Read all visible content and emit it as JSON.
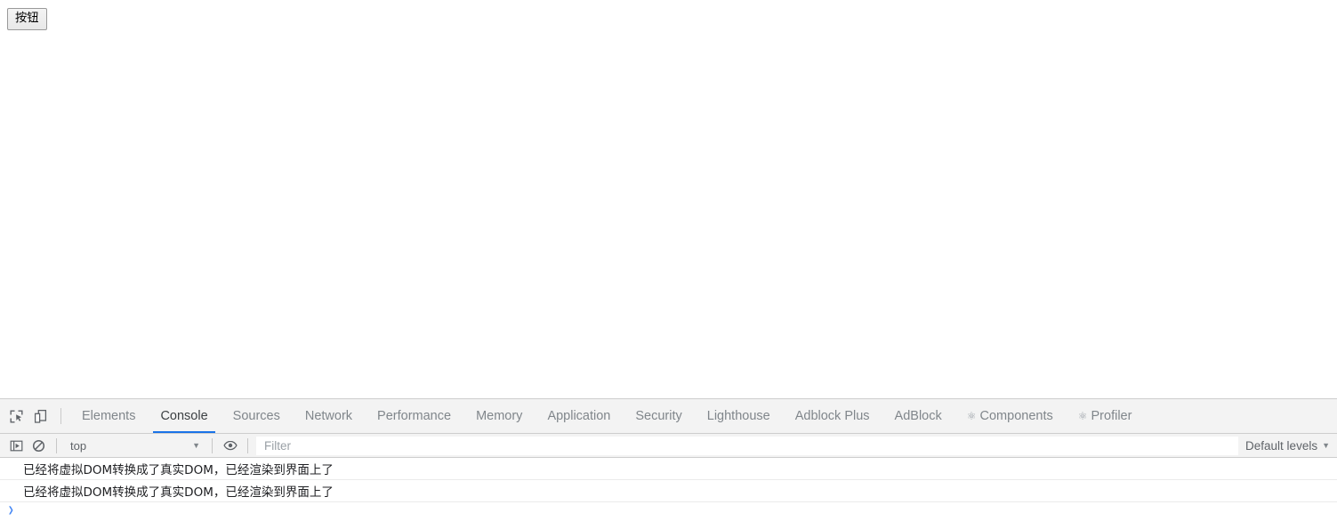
{
  "page": {
    "button_label": "按钮"
  },
  "devtools": {
    "left_icons": [
      {
        "name": "inspect-element-icon",
        "title": "Inspect"
      },
      {
        "name": "device-toolbar-icon",
        "title": "Toggle device toolbar"
      }
    ],
    "tabs": [
      {
        "label": "Elements",
        "active": false,
        "glyph": ""
      },
      {
        "label": "Console",
        "active": true,
        "glyph": ""
      },
      {
        "label": "Sources",
        "active": false,
        "glyph": ""
      },
      {
        "label": "Network",
        "active": false,
        "glyph": ""
      },
      {
        "label": "Performance",
        "active": false,
        "glyph": ""
      },
      {
        "label": "Memory",
        "active": false,
        "glyph": ""
      },
      {
        "label": "Application",
        "active": false,
        "glyph": ""
      },
      {
        "label": "Security",
        "active": false,
        "glyph": ""
      },
      {
        "label": "Lighthouse",
        "active": false,
        "glyph": ""
      },
      {
        "label": "Adblock Plus",
        "active": false,
        "glyph": ""
      },
      {
        "label": "AdBlock",
        "active": false,
        "glyph": ""
      },
      {
        "label": "Components",
        "active": false,
        "glyph": "⚛"
      },
      {
        "label": "Profiler",
        "active": false,
        "glyph": "⚛"
      }
    ],
    "console_toolbar": {
      "sidebar_toggle_name": "console-sidebar-toggle-icon",
      "clear_console_name": "clear-console-icon",
      "context_value": "top",
      "context_caret": "▼",
      "live_expression_name": "eye-icon",
      "filter_placeholder": "Filter",
      "filter_value": "",
      "levels_label": "Default levels",
      "levels_caret": "▼"
    },
    "messages": [
      {
        "text": "已经将虚拟DOM转换成了真实DOM，已经渲染到界面上了"
      },
      {
        "text": "已经将虚拟DOM转换成了真实DOM，已经渲染到界面上了"
      }
    ],
    "prompt_symbol": "❯"
  },
  "colors": {
    "accent": "#1a73e8",
    "toolbar_bg": "#f3f3f3",
    "border": "#cdcdcd",
    "text": "#3c4043",
    "muted_text": "#80868b",
    "prompt": "#4285f4"
  }
}
